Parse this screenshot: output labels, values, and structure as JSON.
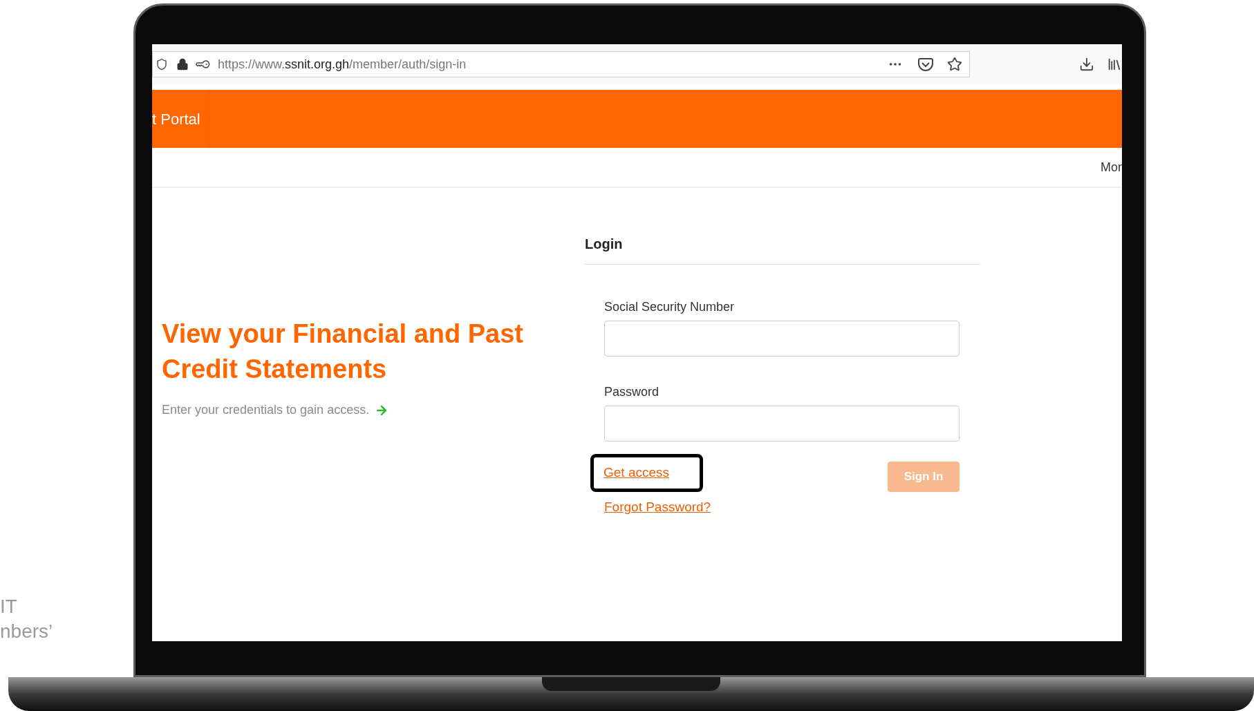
{
  "side_caption": {
    "lines": [
      "IT",
      "nbers’"
    ]
  },
  "browser": {
    "url": {
      "prefix": "https://www.",
      "host": "ssnit.org.gh",
      "path": "/member/auth/sign-in"
    }
  },
  "header": {
    "title": "t Portal"
  },
  "nav": {
    "items": [
      "Mor"
    ]
  },
  "promo": {
    "heading": "View your Financial and Past Credit Statements",
    "subtext": "Enter your credentials to gain access."
  },
  "login": {
    "title": "Login",
    "fields": [
      {
        "label": "Social Security Number"
      },
      {
        "label": "Password"
      }
    ],
    "get_access": {
      "label": "Get access",
      "highlighted": true
    },
    "forgot": "Forgot Password?",
    "sign_in": {
      "label": "Sign In",
      "disabled": true
    }
  }
}
